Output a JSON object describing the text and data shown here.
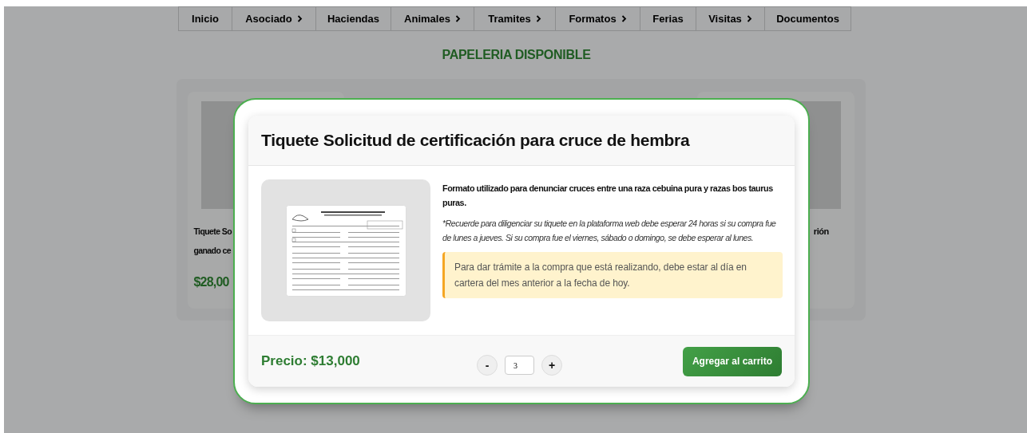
{
  "nav": {
    "items": [
      {
        "label": "Inicio",
        "submenu": false
      },
      {
        "label": "Asociado",
        "submenu": true
      },
      {
        "label": "Haciendas",
        "submenu": false
      },
      {
        "label": "Animales",
        "submenu": true
      },
      {
        "label": "Tramites",
        "submenu": true
      },
      {
        "label": "Formatos",
        "submenu": true
      },
      {
        "label": "Ferias",
        "submenu": false
      },
      {
        "label": "Visitas",
        "submenu": true
      },
      {
        "label": "Documentos",
        "submenu": false
      }
    ]
  },
  "page_title": "PAPELERIA DISPONIBLE",
  "background_cards": [
    {
      "title_lines": [
        "Tiquete So",
        "ganado ce"
      ],
      "price": "$28,00"
    },
    {
      "title_lines": [
        "rión"
      ]
    }
  ],
  "modal": {
    "title": "Tiquete Solicitud de certificación para cruce de hembra",
    "description": "Formato utilizado para denunciar cruces entre una raza cebuina pura y razas bos taurus puras.",
    "note": "*Recuerde para diligenciar su tiquete en la plataforma web debe esperar 24 horas si su compra fue de lunes a jueves. Si su compra fue el viernes, sábado o domingo, se debe esperar al lunes.",
    "alert": "Para dar trámite a la compra que está realizando, debe estar al día en cartera del mes anterior a la fecha de hoy.",
    "price": "Precio: $13,000",
    "quantity": {
      "decrement": "-",
      "value": "3",
      "increment": "+"
    },
    "button": "Agregar al carrito"
  }
}
